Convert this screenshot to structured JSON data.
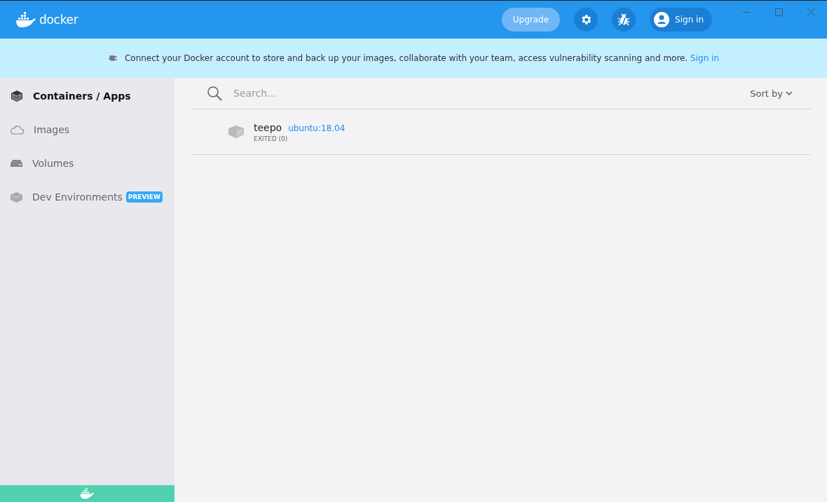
{
  "header": {
    "logo_text": "docker",
    "upgrade": "Upgrade",
    "sign_in": "Sign in"
  },
  "banner": {
    "text": "Connect your Docker account to store and back up your images, collaborate with your team, access vulnerability scanning and more.",
    "link": "Sign in"
  },
  "sidebar": {
    "items": [
      {
        "kind": "containers",
        "label": "Containers / Apps",
        "selected": true
      },
      {
        "kind": "images",
        "label": "Images",
        "selected": false
      },
      {
        "kind": "volumes",
        "label": "Volumes",
        "selected": false
      },
      {
        "kind": "dev",
        "label": "Dev Environments",
        "selected": false,
        "badge": "PREVIEW"
      }
    ]
  },
  "search": {
    "placeholder": "Search..."
  },
  "sort": {
    "label": "Sort by"
  },
  "containers": [
    {
      "name": "teepo",
      "image": "ubuntu:18.04",
      "status": "EXITED (0)"
    }
  ]
}
